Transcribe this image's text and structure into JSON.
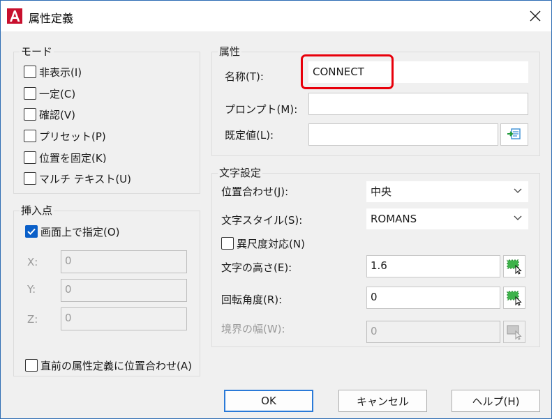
{
  "window": {
    "title": "属性定義",
    "icon": "autocad-a-icon",
    "close_icon": "close-icon"
  },
  "mode": {
    "title": "モード",
    "items": [
      {
        "label": "非表示(I)",
        "checked": false
      },
      {
        "label": "一定(C)",
        "checked": false
      },
      {
        "label": "確認(V)",
        "checked": false
      },
      {
        "label": "プリセット(P)",
        "checked": false
      },
      {
        "label": "位置を固定(K)",
        "checked": false
      },
      {
        "label": "マルチ テキスト(U)",
        "checked": false
      }
    ]
  },
  "insertion": {
    "title": "挿入点",
    "specify_on_screen": {
      "label": "画面上で指定(O)",
      "checked": true
    },
    "x": {
      "label": "X:",
      "value": "0"
    },
    "y": {
      "label": "Y:",
      "value": "0"
    },
    "z": {
      "label": "Z:",
      "value": "0"
    }
  },
  "attribute": {
    "title": "属性",
    "tag": {
      "label": "名称(T):",
      "value": "CONNECT"
    },
    "prompt": {
      "label": "プロンプト(M):",
      "value": ""
    },
    "default": {
      "label": "既定値(L):",
      "value": ""
    },
    "insert_field_icon": "insert-field-icon"
  },
  "text_settings": {
    "title": "文字設定",
    "justification": {
      "label": "位置合わせ(J):",
      "value": "中央"
    },
    "text_style": {
      "label": "文字スタイル(S):",
      "value": "ROMANS"
    },
    "annotative": {
      "label": "異尺度対応(N)",
      "checked": false
    },
    "text_height": {
      "label": "文字の高さ(E):",
      "value": "1.6"
    },
    "rotation": {
      "label": "回転角度(R):",
      "value": "0"
    },
    "boundary_width": {
      "label": "境界の幅(W):",
      "value": "0"
    }
  },
  "align_below": {
    "label": "直前の属性定義に位置合わせ(A)",
    "checked": false
  },
  "buttons": {
    "ok": "OK",
    "cancel": "キャンセル",
    "help": "ヘルプ(H)"
  },
  "colors": {
    "accent": "#0a5fc8",
    "highlight": "#e8000b",
    "icon_red": "#c8102e"
  }
}
